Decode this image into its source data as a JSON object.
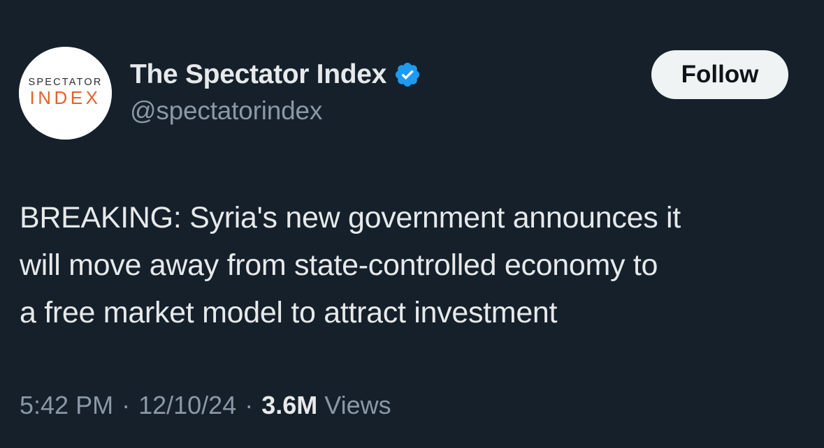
{
  "author": {
    "display_name": "The Spectator Index",
    "handle": "@spectatorindex",
    "verified": true,
    "avatar": {
      "logo_text_top": "SPECTATOR",
      "logo_text_bottom": "INDEX",
      "logo_top_color": "#2c2c2c",
      "logo_bottom_color": "#e4612c"
    }
  },
  "follow_button": {
    "label": "Follow"
  },
  "tweet": {
    "text": "BREAKING: Syria's new government announces it\nwill move away from state-controlled economy to\na free market model to attract investment"
  },
  "meta": {
    "time": "5:42 PM",
    "separator": "·",
    "date": "12/10/24",
    "views_count": "3.6M",
    "views_label": "Views"
  },
  "colors": {
    "background": "#15202b",
    "primary_text": "#e7e9ea",
    "secondary_text": "#8b98a5",
    "verified_badge": "#1d9bf0",
    "button_bg": "#eff3f4",
    "button_text": "#0f1419"
  },
  "icons": {
    "verified": "verified-badge-icon"
  }
}
